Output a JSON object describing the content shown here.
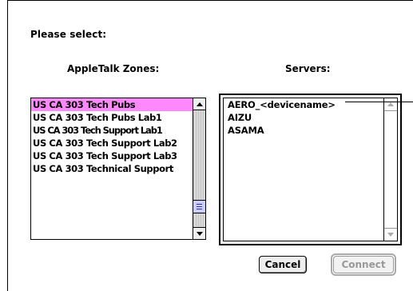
{
  "dialog": {
    "prompt": "Please select:",
    "zones_heading": "AppleTalk Zones:",
    "servers_heading": "Servers:"
  },
  "zones": {
    "items": [
      {
        "label": "US CA 303 Tech Pubs",
        "selected": true
      },
      {
        "label": "US CA 303 Tech Pubs Lab1",
        "selected": false
      },
      {
        "label": "US CA 303 Tech Support Lab1",
        "selected": false
      },
      {
        "label": "US CA 303 Tech Support Lab2",
        "selected": false
      },
      {
        "label": "US CA 303 Tech Support Lab3",
        "selected": false
      },
      {
        "label": "US CA 303 Technical Support",
        "selected": false
      }
    ],
    "selection_color": "#ff88ff"
  },
  "servers": {
    "items": [
      {
        "label": "AERO_<devicename>"
      },
      {
        "label": "AIZU"
      },
      {
        "label": "ASAMA"
      }
    ]
  },
  "buttons": {
    "cancel_label": "Cancel",
    "connect_label": "Connect",
    "connect_enabled": false
  },
  "icons": {
    "scroll_up": "triangle-up-icon",
    "scroll_down": "triangle-down-icon",
    "scroll_thumb_grip": "grip-lines-icon"
  }
}
